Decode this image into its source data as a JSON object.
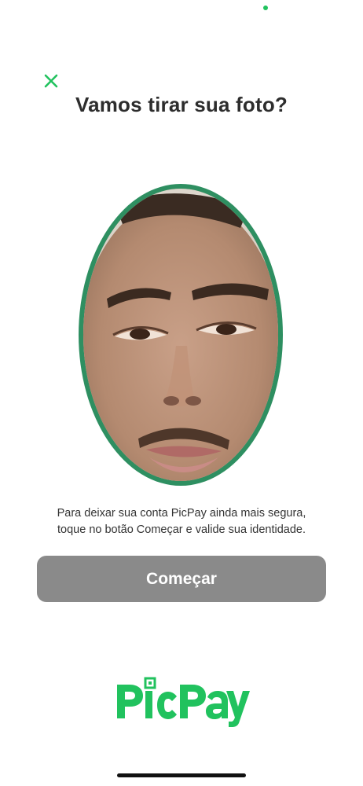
{
  "colors": {
    "brand_green": "#21c25e",
    "frame_green": "#2e8f61",
    "button_disabled": "#8a8a8a"
  },
  "header": {
    "close_icon": "close-icon",
    "title": "Vamos tirar sua foto?"
  },
  "camera": {
    "icon": "face-camera-preview"
  },
  "instructions": {
    "line1": "Para deixar sua conta PicPay ainda mais segura,",
    "line2": "toque no botão Começar e valide sua identidade."
  },
  "actions": {
    "start_label": "Começar"
  },
  "brand": {
    "logo_text": "PicPay"
  }
}
